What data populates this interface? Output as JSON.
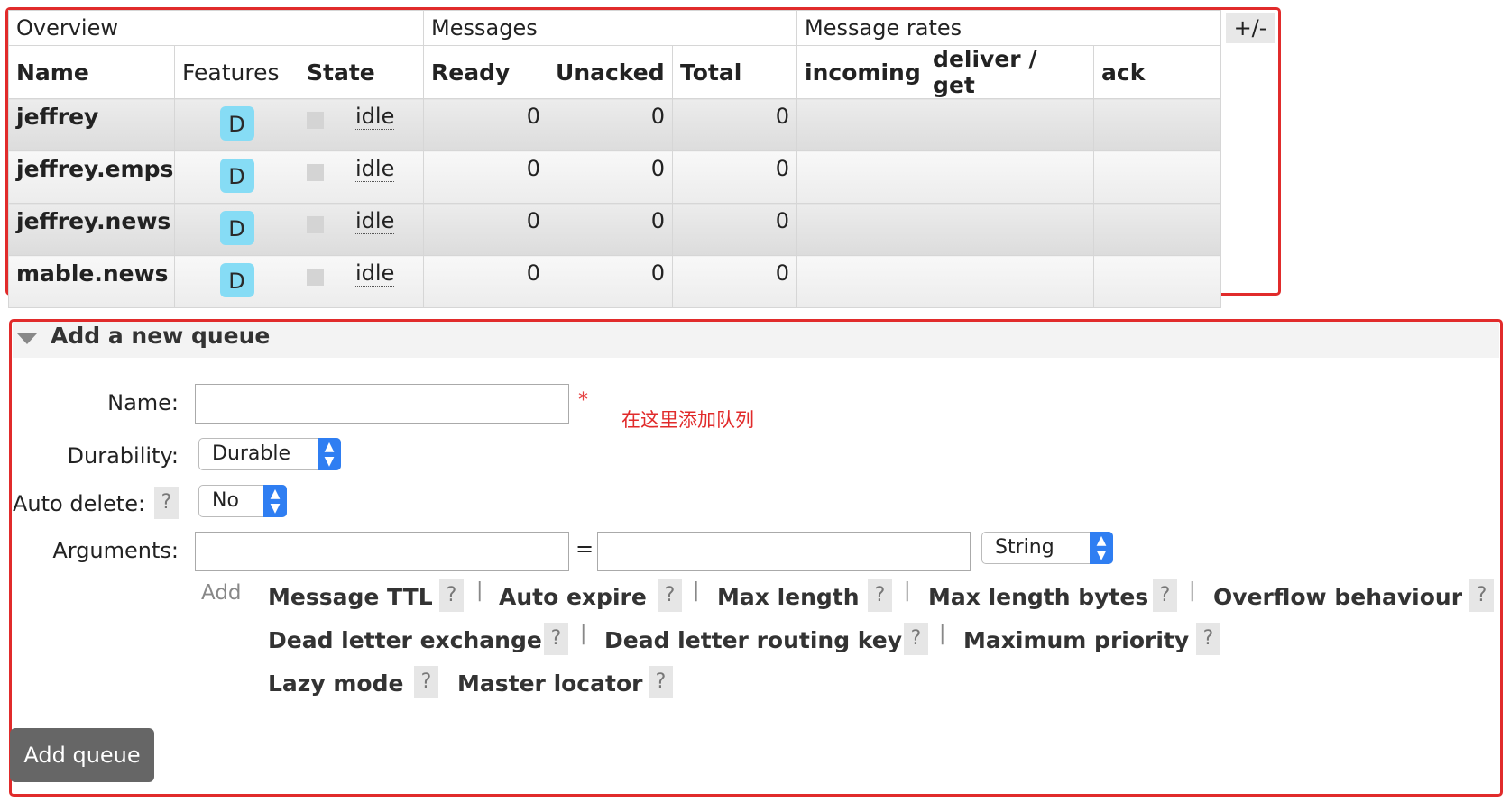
{
  "queues_table": {
    "toggle_label": "+/-",
    "group_headers": {
      "overview": "Overview",
      "messages": "Messages",
      "message_rates": "Message rates"
    },
    "columns": {
      "name": "Name",
      "features": "Features",
      "state": "State",
      "ready": "Ready",
      "unacked": "Unacked",
      "total": "Total",
      "incoming": "incoming",
      "deliver_get": "deliver / get",
      "ack": "ack"
    },
    "rows": [
      {
        "name": "jeffrey",
        "feature": "D",
        "state": "idle",
        "ready": "0",
        "unacked": "0",
        "total": "0"
      },
      {
        "name": "jeffrey.emps",
        "feature": "D",
        "state": "idle",
        "ready": "0",
        "unacked": "0",
        "total": "0"
      },
      {
        "name": "jeffrey.news",
        "feature": "D",
        "state": "idle",
        "ready": "0",
        "unacked": "0",
        "total": "0"
      },
      {
        "name": "mable.news",
        "feature": "D",
        "state": "idle",
        "ready": "0",
        "unacked": "0",
        "total": "0"
      }
    ]
  },
  "add_queue": {
    "title": "Add a new queue",
    "name_label": "Name:",
    "name_value": "",
    "required_mark": "*",
    "annotation": "在这里添加队列",
    "durability_label": "Durability:",
    "durability_value": "Durable",
    "auto_delete_label": "Auto delete:",
    "auto_delete_value": "No",
    "arguments_label": "Arguments:",
    "arg_key": "",
    "equals": "=",
    "arg_value": "",
    "arg_type": "String",
    "add_link": "Add",
    "help": "?",
    "separator": "|",
    "arg_shortcuts": [
      "Message TTL",
      "Auto expire",
      "Max length",
      "Max length bytes",
      "Overflow behaviour",
      "Dead letter exchange",
      "Dead letter routing key",
      "Maximum priority",
      "Lazy mode",
      "Master locator"
    ],
    "submit_label": "Add queue"
  },
  "colors": {
    "highlight_border": "#e12b2b",
    "feature_badge": "#86dcf5",
    "select_arrow": "#2f7ef2",
    "button": "#666666"
  }
}
